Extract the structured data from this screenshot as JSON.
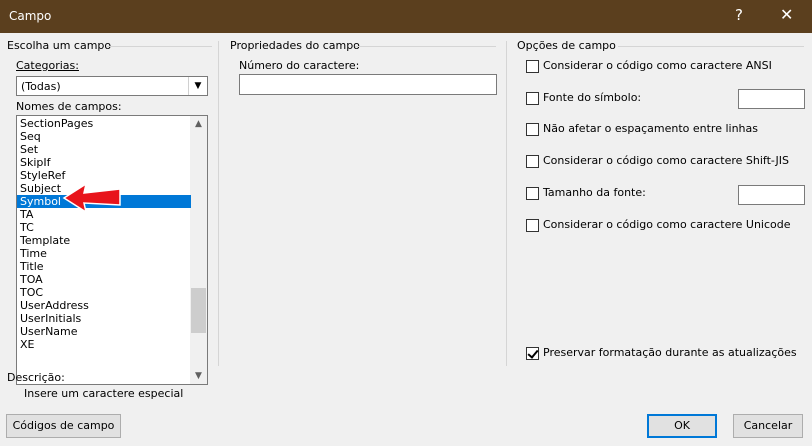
{
  "window": {
    "title": "Campo",
    "help": "?",
    "close": "✕"
  },
  "left": {
    "group_label": "Escolha um campo",
    "categories_label": "Categorias:",
    "categories_value": "(Todas)",
    "field_names_label": "Nomes de campos:",
    "field_names": [
      "SectionPages",
      "Seq",
      "Set",
      "SkipIf",
      "StyleRef",
      "Subject",
      "Symbol",
      "TA",
      "TC",
      "Template",
      "Time",
      "Title",
      "TOA",
      "TOC",
      "UserAddress",
      "UserInitials",
      "UserName",
      "XE"
    ],
    "selected_field": "Symbol"
  },
  "middle": {
    "group_label": "Propriedades do campo",
    "char_number_label": "Número do caractere:",
    "char_number_value": ""
  },
  "right": {
    "group_label": "Opções de campo",
    "options": [
      {
        "label": "Considerar o código como caractere ANSI",
        "checked": false
      },
      {
        "label": "Fonte do símbolo:",
        "checked": false
      },
      {
        "label": "Não afetar o espaçamento entre linhas",
        "checked": false
      },
      {
        "label": "Considerar o código como caractere Shift-JIS",
        "checked": false
      },
      {
        "label": "Tamanho da fonte:",
        "checked": false
      },
      {
        "label": "Considerar o código como caractere Unicode",
        "checked": false
      }
    ],
    "preserve": {
      "label": "Preservar formatação durante as atualizações",
      "checked": true
    }
  },
  "description": {
    "label": "Descrição:",
    "text": "Insere um caractere especial"
  },
  "buttons": {
    "field_codes": "Códigos de campo",
    "ok": "OK",
    "cancel": "Cancelar"
  },
  "icons": {
    "annotation": "red-arrow-icon"
  },
  "colors": {
    "titlebar": "#5b3f1e",
    "selection": "#0078d7",
    "annotation_arrow": "#e8141b"
  }
}
